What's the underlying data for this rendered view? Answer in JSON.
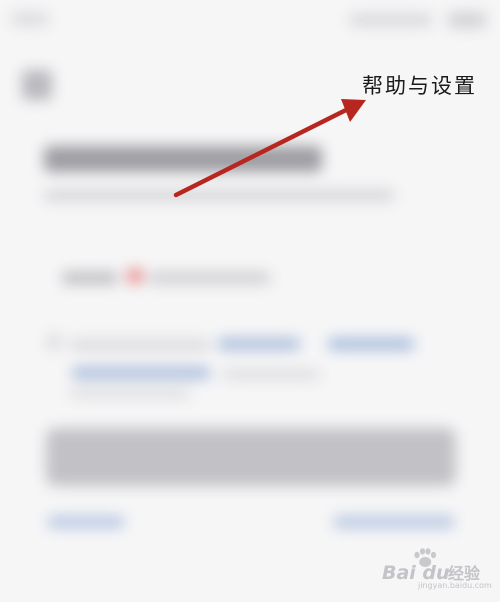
{
  "annotation": {
    "label": "帮助与设置",
    "arrow_color": "#b8271f"
  },
  "watermark": {
    "logo": "Bai du",
    "brand": "经验",
    "url": "jingyan.baidu.com"
  },
  "colors": {
    "background": "#f6f6f7",
    "button_gray": "#c2c2c6",
    "link_blue": "#a9bddb",
    "badge_red": "#e98585"
  }
}
